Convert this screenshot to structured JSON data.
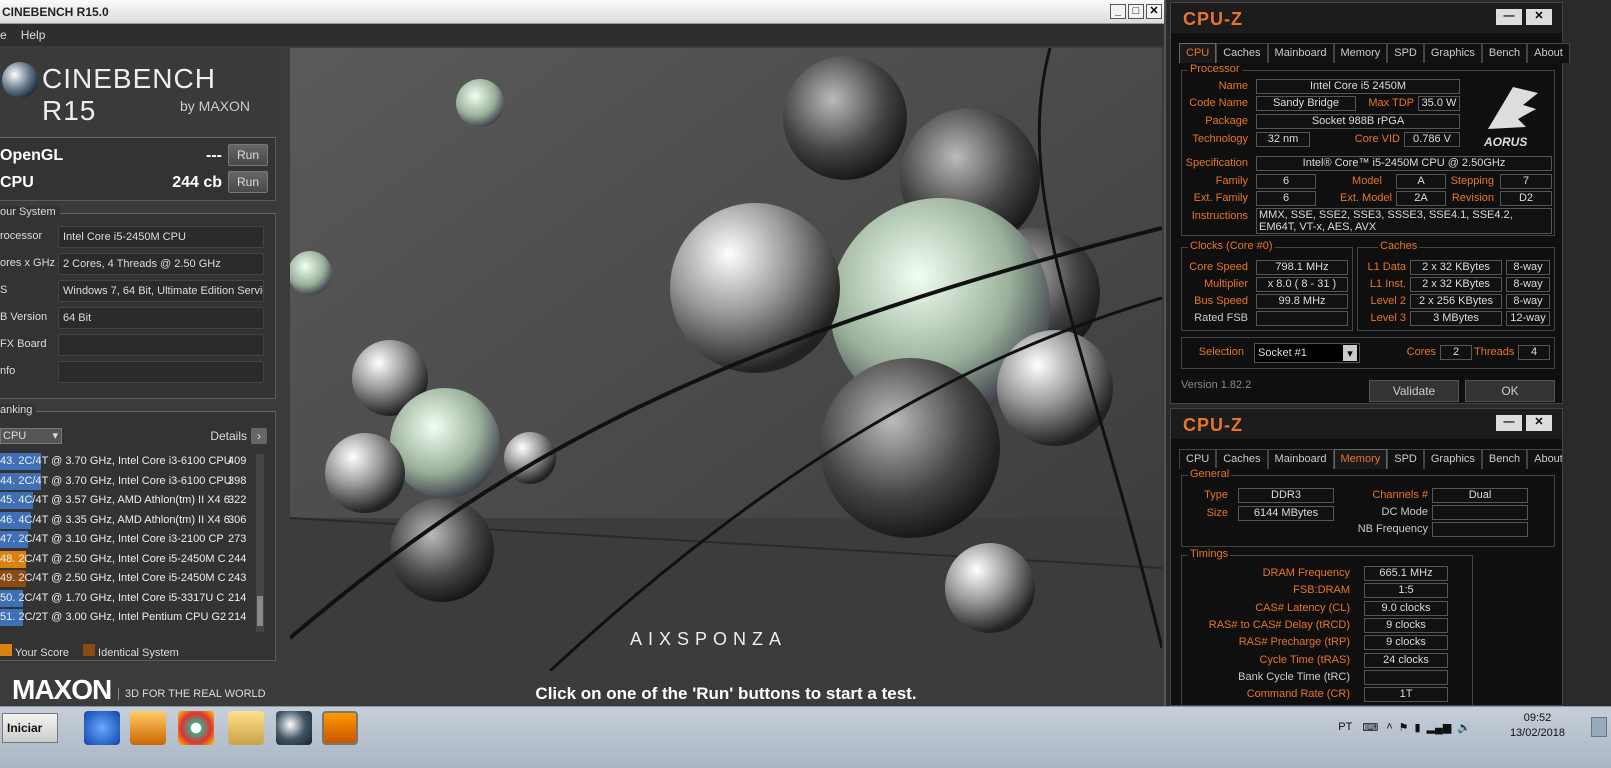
{
  "cinebench": {
    "title": "CINEBENCH R15.0",
    "menu": [
      "e",
      "Help"
    ],
    "logo_text": "CINEBENCH R15",
    "logo_by": "by MAXON",
    "tests": [
      {
        "label": "OpenGL",
        "value": "---",
        "run": "Run"
      },
      {
        "label": "CPU",
        "value": "244 cb",
        "run": "Run"
      }
    ],
    "system_header": "our System",
    "system": [
      {
        "key": "rocessor",
        "value": "Intel Core i5-2450M CPU"
      },
      {
        "key": "ores x GHz",
        "value": "2 Cores, 4 Threads @ 2.50 GHz"
      },
      {
        "key": "S",
        "value": "Windows 7, 64 Bit, Ultimate Edition Service"
      },
      {
        "key": "B Version",
        "value": "64 Bit"
      },
      {
        "key": "FX Board",
        "value": ""
      },
      {
        "key": "nfo",
        "value": ""
      }
    ],
    "ranking_header": "anking",
    "ranking_select": "CPU",
    "details_label": "Details",
    "ranking": [
      {
        "text": "43. 2C/4T @ 3.70 GHz, Intel Core i3-6100 CPU",
        "score": "409",
        "bar": 0.16,
        "color": "#3f6fb5"
      },
      {
        "text": "44. 2C/4T @ 3.70 GHz, Intel Core i3-6100 CPU",
        "score": "398",
        "bar": 0.16,
        "color": "#3f6fb5"
      },
      {
        "text": "45. 4C/4T @ 3.57 GHz, AMD Athlon(tm) II X4 6",
        "score": "322",
        "bar": 0.13,
        "color": "#3f6fb5"
      },
      {
        "text": "46. 4C/4T @ 3.35 GHz, AMD Athlon(tm) II X4 6",
        "score": "306",
        "bar": 0.12,
        "color": "#3f6fb5"
      },
      {
        "text": "47. 2C/4T @ 3.10 GHz,  Intel Core i3-2100 CP",
        "score": "273",
        "bar": 0.11,
        "color": "#3f6fb5"
      },
      {
        "text": "48. 2C/4T @ 2.50 GHz,  Intel Core i5-2450M C",
        "score": "244",
        "bar": 0.1,
        "color": "#d9820e"
      },
      {
        "text": "49. 2C/4T @ 2.50 GHz,  Intel Core i5-2450M C",
        "score": "243",
        "bar": 0.1,
        "color": "#8a4a12"
      },
      {
        "text": "50. 2C/4T @ 1.70 GHz,  Intel Core i5-3317U C",
        "score": "214",
        "bar": 0.09,
        "color": "#3f6fb5"
      },
      {
        "text": "51. 2C/2T @ 3.00 GHz,  Intel Pentium CPU G2",
        "score": "214",
        "bar": 0.09,
        "color": "#3f6fb5"
      }
    ],
    "legend_your": "Your Score",
    "legend_identical": "Identical System",
    "maxon_logo": "MAXON",
    "maxon_tag": "3D FOR THE REAL WORLD",
    "render_watermark": "AIXSPONZA",
    "status": "Click on one of the 'Run' buttons to start a test."
  },
  "cpuz1": {
    "title": "CPU-Z",
    "tabs": [
      "CPU",
      "Caches",
      "Mainboard",
      "Memory",
      "SPD",
      "Graphics",
      "Bench",
      "About"
    ],
    "active_tab": "CPU",
    "processor_header": "Processor",
    "name_k": "Name",
    "name": "Intel Core i5 2450M",
    "codename_k": "Code Name",
    "codename": "Sandy Bridge",
    "maxtdp_k": "Max TDP",
    "maxtdp": "35.0 W",
    "package_k": "Package",
    "package": "Socket 988B rPGA",
    "technology_k": "Technology",
    "technology": "32 nm",
    "corevid_k": "Core VID",
    "corevid": "0.786 V",
    "spec_k": "Specification",
    "spec": "Intel® Core™ i5-2450M CPU @ 2.50GHz",
    "family_k": "Family",
    "family": "6",
    "model_k": "Model",
    "model": "A",
    "stepping_k": "Stepping",
    "stepping": "7",
    "extfamily_k": "Ext. Family",
    "extfamily": "6",
    "extmodel_k": "Ext. Model",
    "extmodel": "2A",
    "revision_k": "Revision",
    "revision": "D2",
    "instr_k": "Instructions",
    "instr": "MMX, SSE, SSE2, SSE3, SSSE3, SSE4.1, SSE4.2, EM64T, VT-x, AES, AVX",
    "clocks_header": "Clocks (Core #0)",
    "corespeed_k": "Core Speed",
    "corespeed": "798.1 MHz",
    "multiplier_k": "Multiplier",
    "multiplier": "x 8.0 ( 8 - 31 )",
    "busspeed_k": "Bus Speed",
    "busspeed": "99.8 MHz",
    "ratedfsb_k": "Rated FSB",
    "ratedfsb": "",
    "caches_header": "Caches",
    "l1d_k": "L1 Data",
    "l1d": "2 x 32 KBytes",
    "l1d_w": "8-way",
    "l1i_k": "L1 Inst.",
    "l1i": "2 x 32 KBytes",
    "l1i_w": "8-way",
    "l2_k": "Level 2",
    "l2": "2 x 256 KBytes",
    "l2_w": "8-way",
    "l3_k": "Level 3",
    "l3": "3 MBytes",
    "l3_w": "12-way",
    "selection_k": "Selection",
    "selection": "Socket #1",
    "cores_k": "Cores",
    "cores": "2",
    "threads_k": "Threads",
    "threads": "4",
    "version": "Version 1.82.2",
    "validate": "Validate",
    "ok": "OK",
    "brand": "AORUS"
  },
  "cpuz2": {
    "title": "CPU-Z",
    "tabs": [
      "CPU",
      "Caches",
      "Mainboard",
      "Memory",
      "SPD",
      "Graphics",
      "Bench",
      "About"
    ],
    "active_tab": "Memory",
    "general_header": "General",
    "type_k": "Type",
    "type": "DDR3",
    "size_k": "Size",
    "size": "6144 MBytes",
    "channels_k": "Channels #",
    "channels": "Dual",
    "dcmode_k": "DC Mode",
    "dcmode": "",
    "nbfreq_k": "NB Frequency",
    "nbfreq": "",
    "timings_header": "Timings",
    "timings": [
      {
        "k": "DRAM Frequency",
        "v": "665.1 MHz"
      },
      {
        "k": "FSB:DRAM",
        "v": "1:5"
      },
      {
        "k": "CAS# Latency (CL)",
        "v": "9.0 clocks"
      },
      {
        "k": "RAS# to CAS# Delay (tRCD)",
        "v": "9 clocks"
      },
      {
        "k": "RAS# Precharge (tRP)",
        "v": "9 clocks"
      },
      {
        "k": "Cycle Time (tRAS)",
        "v": "24 clocks"
      },
      {
        "k": "Bank Cycle Time (tRC)",
        "v": ""
      },
      {
        "k": "Command Rate (CR)",
        "v": "1T"
      }
    ]
  },
  "taskbar": {
    "start": "Iniciar",
    "lang": "PT",
    "time": "09:52",
    "date": "13/02/2018"
  }
}
